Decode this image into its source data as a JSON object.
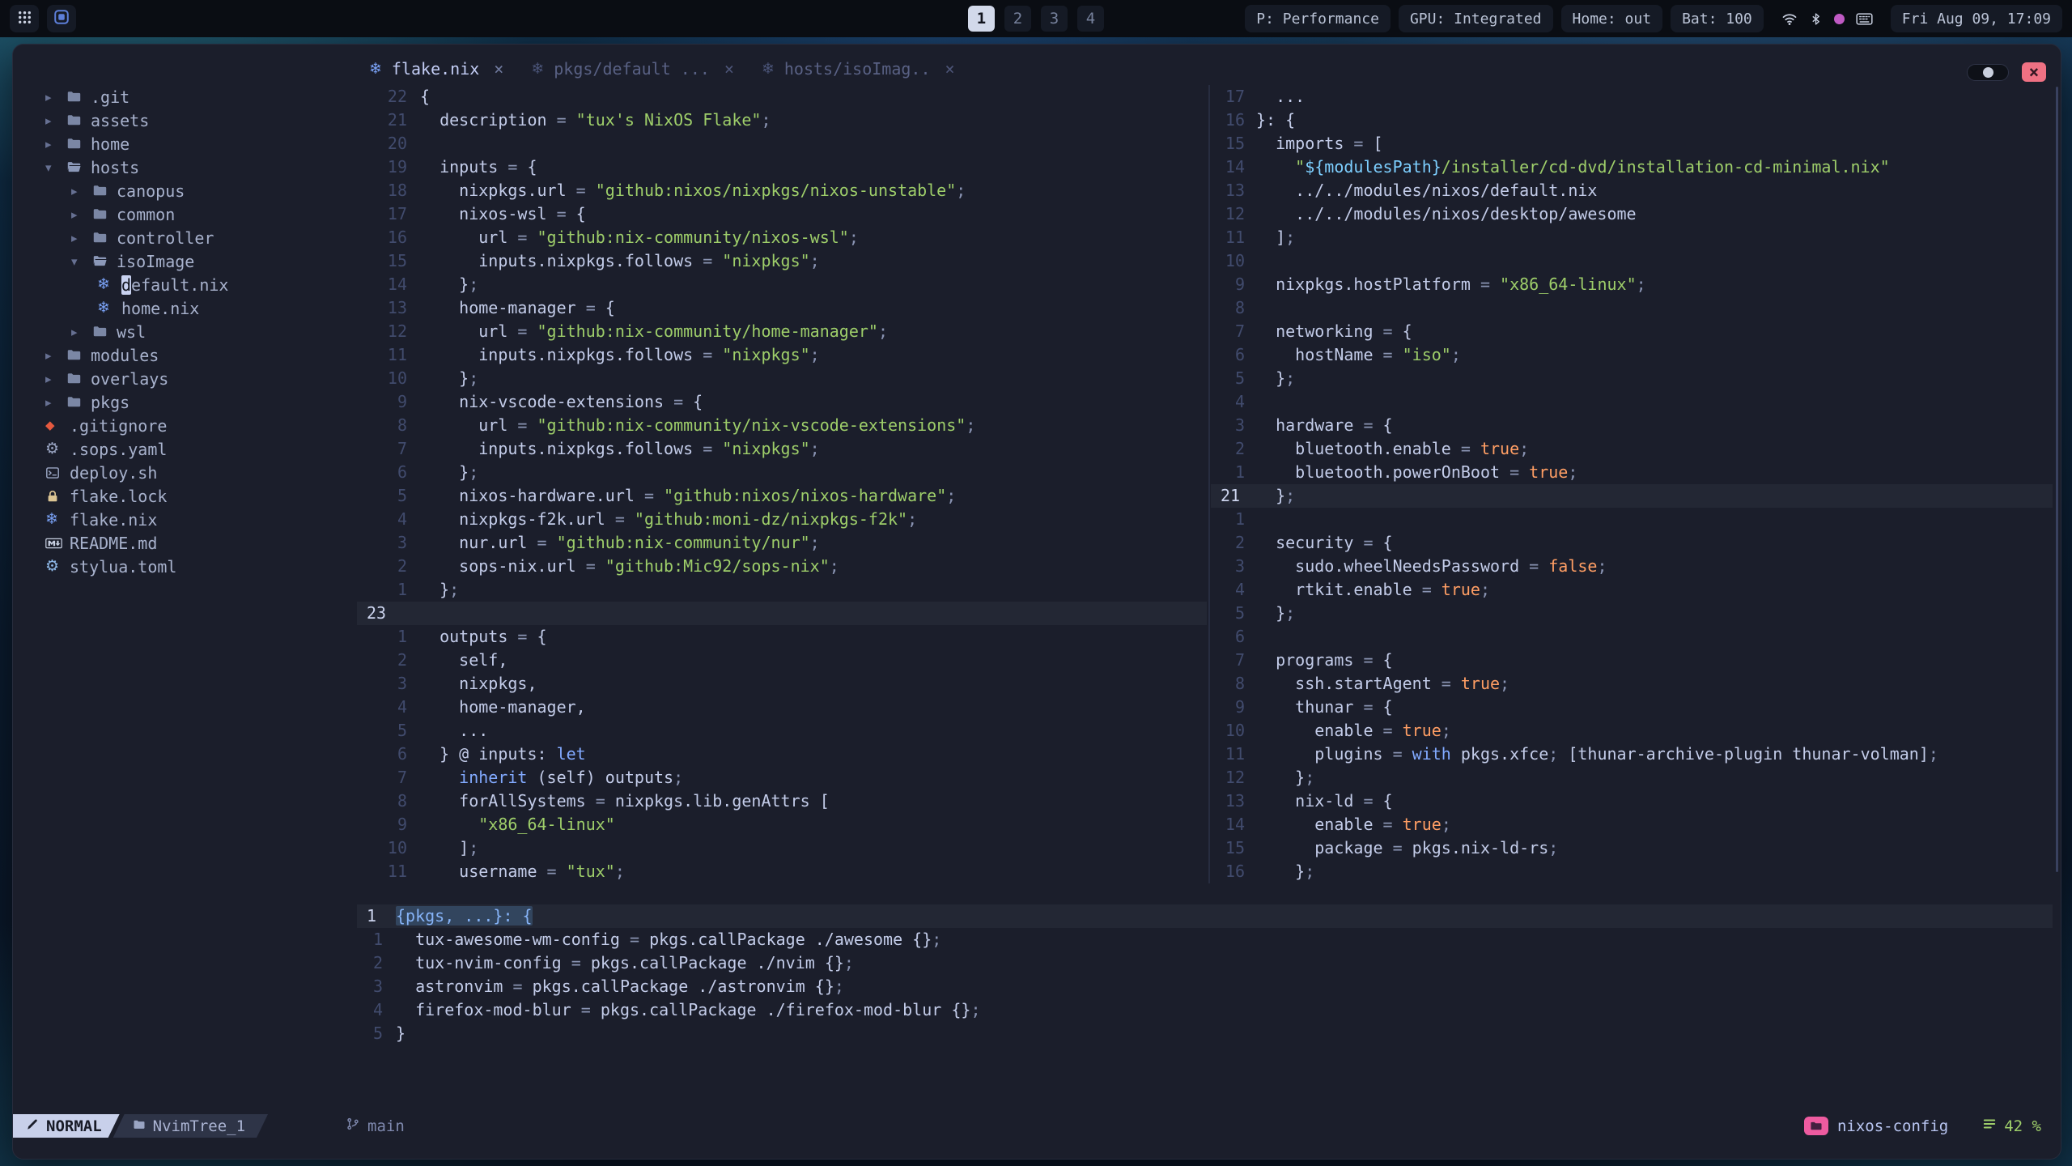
{
  "palette": {
    "bg": "#1b1e2b",
    "fg": "#c3cce9",
    "accent": "#7aa2f7",
    "str": "#9ece6a",
    "bool": "#ff9e64",
    "kw": "#82aaff",
    "op": "#8a94b3",
    "dim": "#5b6485",
    "linenr": "#414b6d",
    "linenr_cur": "#ccd4ee",
    "modebg": "#c8d0ea",
    "chipbg": "#2e3447",
    "branchfg": "#7e88ad",
    "pink": "#ee5ba0",
    "green": "#9ece6a",
    "close": "#ef7183",
    "sel": "#32455e",
    "treefg": "#a8b2cd",
    "barbg": "#0a0d13",
    "barchip": "#151a25",
    "barfg": "#bac3d6",
    "wsbg": "#d2d9ea",
    "wsfg": "#10131c",
    "sep": "#272d40",
    "param": "#86b3f7",
    "interp": "#7dcfff"
  },
  "topbar": {
    "workspaces": [
      {
        "label": "1",
        "active": true
      },
      {
        "label": "2",
        "active": false
      },
      {
        "label": "3",
        "active": false
      },
      {
        "label": "4",
        "active": false
      }
    ],
    "segments": [
      {
        "name": "power-profile",
        "label": "P: Performance"
      },
      {
        "name": "gpu-mode",
        "label": "GPU: Integrated"
      },
      {
        "name": "home-presence",
        "label": "Home: out"
      },
      {
        "name": "battery",
        "label": "Bat: 100"
      }
    ],
    "tray_icons": [
      "wifi",
      "bluetooth",
      "indicator-dot",
      "keyboard"
    ],
    "clock": "Fri Aug 09, 17:09"
  },
  "window": {
    "tabs": [
      {
        "title": "flake.nix",
        "active": true,
        "close_glyph": "×"
      },
      {
        "title": "pkgs/default ...",
        "active": false,
        "close_glyph": "×"
      },
      {
        "title": "hosts/isoImag..",
        "active": false,
        "close_glyph": "×"
      }
    ],
    "close_glyph": "×"
  },
  "filetree": {
    "items": [
      {
        "depth": 0,
        "chev": "right",
        "icon": "folder",
        "color": "#7b87a5",
        "label": ".git"
      },
      {
        "depth": 0,
        "chev": "right",
        "icon": "folder",
        "color": "#7b87a5",
        "label": "assets"
      },
      {
        "depth": 0,
        "chev": "right",
        "icon": "folder",
        "color": "#7b87a5",
        "label": "home"
      },
      {
        "depth": 0,
        "chev": "down",
        "icon": "folder_open",
        "color": "#8b98b8",
        "label": "hosts"
      },
      {
        "depth": 1,
        "chev": "right",
        "icon": "folder",
        "color": "#7b87a5",
        "label": "canopus"
      },
      {
        "depth": 1,
        "chev": "right",
        "icon": "folder",
        "color": "#7b87a5",
        "label": "common"
      },
      {
        "depth": 1,
        "chev": "right",
        "icon": "folder",
        "color": "#7b87a5",
        "label": "controller"
      },
      {
        "depth": 1,
        "chev": "down",
        "icon": "folder_open",
        "color": "#8b98b8",
        "label": "isoImage"
      },
      {
        "depth": 2,
        "chev": "",
        "icon": "nix",
        "color": "#7aa2f7",
        "label": "default.nix",
        "cursor": true
      },
      {
        "depth": 2,
        "chev": "",
        "icon": "nix",
        "color": "#7aa2f7",
        "label": "home.nix"
      },
      {
        "depth": 1,
        "chev": "right",
        "icon": "folder",
        "color": "#7b87a5",
        "label": "wsl"
      },
      {
        "depth": 0,
        "chev": "right",
        "icon": "folder",
        "color": "#7b87a5",
        "label": "modules"
      },
      {
        "depth": 0,
        "chev": "right",
        "icon": "folder",
        "color": "#7b87a5",
        "label": "overlays"
      },
      {
        "depth": 0,
        "chev": "right",
        "icon": "folder",
        "color": "#7b87a5",
        "label": "pkgs"
      },
      {
        "depth": 0,
        "chev": "",
        "icon": "git",
        "color": "#e5593f",
        "label": ".gitignore"
      },
      {
        "depth": 0,
        "chev": "",
        "icon": "gear",
        "color": "#9aa5c3",
        "label": ".sops.yaml"
      },
      {
        "depth": 0,
        "chev": "",
        "icon": "shell",
        "color": "#9aa5c3",
        "label": "deploy.sh"
      },
      {
        "depth": 0,
        "chev": "",
        "icon": "lock",
        "color": "#dcc594",
        "label": "flake.lock"
      },
      {
        "depth": 0,
        "chev": "",
        "icon": "nix",
        "color": "#7aa2f7",
        "label": "flake.nix"
      },
      {
        "depth": 0,
        "chev": "",
        "icon": "markdown",
        "color": "#c9d1e3",
        "label": "README.md"
      },
      {
        "depth": 0,
        "chev": "",
        "icon": "gear",
        "color": "#8fb9e8",
        "label": "stylua.toml"
      }
    ]
  },
  "editor": {
    "left": {
      "lines": [
        {
          "n": "22",
          "t": "{"
        },
        {
          "n": "21",
          "t": "  description = \"tux's NixOS Flake\";"
        },
        {
          "n": "20",
          "t": ""
        },
        {
          "n": "19",
          "t": "  inputs = {"
        },
        {
          "n": "18",
          "t": "    nixpkgs.url = \"github:nixos/nixpkgs/nixos-unstable\";"
        },
        {
          "n": "17",
          "t": "    nixos-wsl = {"
        },
        {
          "n": "16",
          "t": "      url = \"github:nix-community/nixos-wsl\";"
        },
        {
          "n": "15",
          "t": "      inputs.nixpkgs.follows = \"nixpkgs\";"
        },
        {
          "n": "14",
          "t": "    };"
        },
        {
          "n": "13",
          "t": "    home-manager = {"
        },
        {
          "n": "12",
          "t": "      url = \"github:nix-community/home-manager\";"
        },
        {
          "n": "11",
          "t": "      inputs.nixpkgs.follows = \"nixpkgs\";"
        },
        {
          "n": "10",
          "t": "    };"
        },
        {
          "n": "9",
          "t": "    nix-vscode-extensions = {"
        },
        {
          "n": "8",
          "t": "      url = \"github:nix-community/nix-vscode-extensions\";"
        },
        {
          "n": "7",
          "t": "      inputs.nixpkgs.follows = \"nixpkgs\";"
        },
        {
          "n": "6",
          "t": "    };"
        },
        {
          "n": "5",
          "t": "    nixos-hardware.url = \"github:nixos/nixos-hardware\";"
        },
        {
          "n": "4",
          "t": "    nixpkgs-f2k.url = \"github:moni-dz/nixpkgs-f2k\";"
        },
        {
          "n": "3",
          "t": "    nur.url = \"github:nix-community/nur\";"
        },
        {
          "n": "2",
          "t": "    sops-nix.url = \"github:Mic92/sops-nix\";"
        },
        {
          "n": "1",
          "t": "  };"
        },
        {
          "n": "23",
          "t": "",
          "cur": true
        },
        {
          "n": "1",
          "t": "  outputs = {"
        },
        {
          "n": "2",
          "t": "    self,"
        },
        {
          "n": "3",
          "t": "    nixpkgs,"
        },
        {
          "n": "4",
          "t": "    home-manager,"
        },
        {
          "n": "5",
          "t": "    ..."
        },
        {
          "n": "6",
          "t": "  } @ inputs: let"
        },
        {
          "n": "7",
          "t": "    inherit (self) outputs;"
        },
        {
          "n": "8",
          "t": "    forAllSystems = nixpkgs.lib.genAttrs ["
        },
        {
          "n": "9",
          "t": "      \"x86_64-linux\""
        },
        {
          "n": "10",
          "t": "    ];"
        },
        {
          "n": "11",
          "t": "    username = \"tux\";"
        }
      ]
    },
    "right": {
      "lines": [
        {
          "n": "17",
          "t": "  ..."
        },
        {
          "n": "16",
          "t": "}: {"
        },
        {
          "n": "15",
          "t": "  imports = ["
        },
        {
          "n": "14",
          "t": "    \"${modulesPath}/installer/cd-dvd/installation-cd-minimal.nix\""
        },
        {
          "n": "13",
          "t": "    ../../modules/nixos/default.nix"
        },
        {
          "n": "12",
          "t": "    ../../modules/nixos/desktop/awesome"
        },
        {
          "n": "11",
          "t": "  ];"
        },
        {
          "n": "10",
          "t": ""
        },
        {
          "n": "9",
          "t": "  nixpkgs.hostPlatform = \"x86_64-linux\";"
        },
        {
          "n": "8",
          "t": ""
        },
        {
          "n": "7",
          "t": "  networking = {"
        },
        {
          "n": "6",
          "t": "    hostName = \"iso\";"
        },
        {
          "n": "5",
          "t": "  };"
        },
        {
          "n": "4",
          "t": ""
        },
        {
          "n": "3",
          "t": "  hardware = {"
        },
        {
          "n": "2",
          "t": "    bluetooth.enable = true;"
        },
        {
          "n": "1",
          "t": "    bluetooth.powerOnBoot = true;"
        },
        {
          "n": "21",
          "t": "  };",
          "cur": true
        },
        {
          "n": "1",
          "t": ""
        },
        {
          "n": "2",
          "t": "  security = {"
        },
        {
          "n": "3",
          "t": "    sudo.wheelNeedsPassword = false;"
        },
        {
          "n": "4",
          "t": "    rtkit.enable = true;"
        },
        {
          "n": "5",
          "t": "  };"
        },
        {
          "n": "6",
          "t": ""
        },
        {
          "n": "7",
          "t": "  programs = {"
        },
        {
          "n": "8",
          "t": "    ssh.startAgent = true;"
        },
        {
          "n": "9",
          "t": "    thunar = {"
        },
        {
          "n": "10",
          "t": "      enable = true;"
        },
        {
          "n": "11",
          "t": "      plugins = with pkgs.xfce; [thunar-archive-plugin thunar-volman];"
        },
        {
          "n": "12",
          "t": "    };"
        },
        {
          "n": "13",
          "t": "    nix-ld = {"
        },
        {
          "n": "14",
          "t": "      enable = true;"
        },
        {
          "n": "15",
          "t": "      package = pkgs.nix-ld-rs;"
        },
        {
          "n": "16",
          "t": "    };"
        }
      ]
    },
    "bottom": {
      "lines": [
        {
          "n": "1",
          "t": "{pkgs, ...}: {",
          "cur": true,
          "sel": true,
          "param": true
        },
        {
          "n": "1",
          "t": "  tux-awesome-wm-config = pkgs.callPackage ./awesome {};"
        },
        {
          "n": "2",
          "t": "  tux-nvim-config = pkgs.callPackage ./nvim {};"
        },
        {
          "n": "3",
          "t": "  astronvim = pkgs.callPackage ./astronvim {};"
        },
        {
          "n": "4",
          "t": "  firefox-mod-blur = pkgs.callPackage ./firefox-mod-blur {};"
        },
        {
          "n": "5",
          "t": "}"
        }
      ]
    }
  },
  "statusline": {
    "mode": "NORMAL",
    "buffer": "NvimTree_1",
    "branch": "main",
    "project": "nixos-config",
    "scroll_percent": "42 %"
  }
}
